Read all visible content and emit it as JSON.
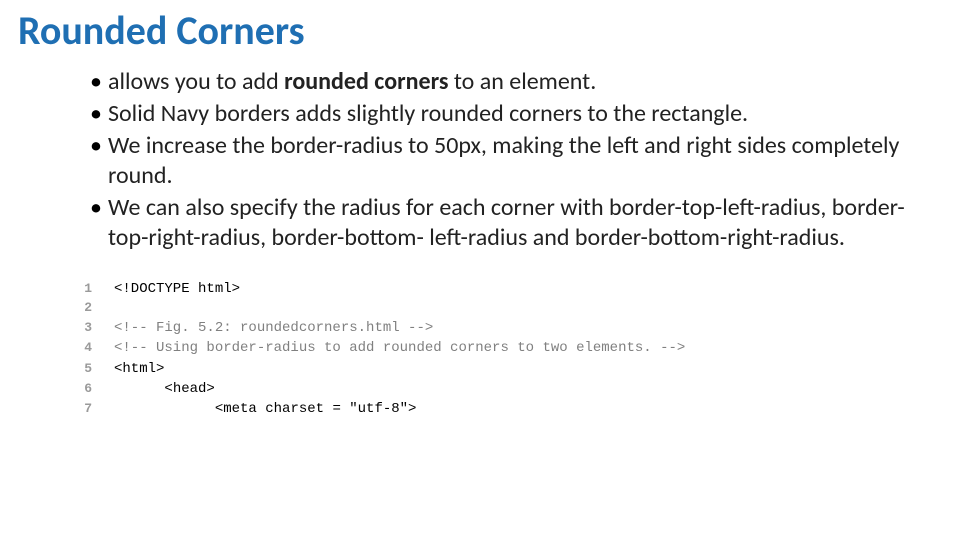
{
  "title": "Rounded Corners",
  "bullets": [
    {
      "pre": "allows you to add ",
      "strong": "rounded corners ",
      "post": "to an element."
    },
    {
      "pre": "Solid Navy borders adds slightly rounded corners to the rectangle.",
      "strong": "",
      "post": ""
    },
    {
      "pre": "We increase the border-radius to 50px, making the left and right sides completely round.",
      "strong": "",
      "post": ""
    },
    {
      "pre": "We can also specify the radius for each corner with border-top-left-radius, border-top-right-radius, border-bottom- left-radius and border-bottom-right-radius.",
      "strong": "",
      "post": ""
    }
  ],
  "code": {
    "lines": [
      {
        "n": "1",
        "indent": "",
        "text": "<!DOCTYPE html>",
        "comment": false
      },
      {
        "n": "2",
        "indent": "",
        "text": "",
        "comment": false
      },
      {
        "n": "3",
        "indent": "",
        "text": "<!-- Fig. 5.2: roundedcorners.html -->",
        "comment": true
      },
      {
        "n": "4",
        "indent": "",
        "text": "<!-- Using border-radius to add rounded corners to two elements. -->",
        "comment": true
      },
      {
        "n": "5",
        "indent": "",
        "text": "<html>",
        "comment": false
      },
      {
        "n": "6",
        "indent": "      ",
        "text": "<head>",
        "comment": false
      },
      {
        "n": "7",
        "indent": "            ",
        "text": "<meta charset = \"utf-8\">",
        "comment": false
      }
    ]
  }
}
